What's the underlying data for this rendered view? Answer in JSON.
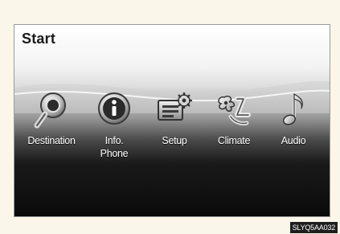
{
  "screen": {
    "title": "Start"
  },
  "menu": {
    "items": [
      {
        "label": "Destination",
        "icon": "magnifier-icon"
      },
      {
        "label": "Info.\nPhone",
        "icon": "info-icon"
      },
      {
        "label": "Setup",
        "icon": "setup-gear-icon"
      },
      {
        "label": "Climate",
        "icon": "climate-fan-icon"
      },
      {
        "label": "Audio",
        "icon": "music-note-icon"
      }
    ]
  },
  "caption": {
    "code": "SLYQ5AA032"
  },
  "colors": {
    "frame_background": "#fbf6ea",
    "label_text": "#ffffff",
    "title_text": "#1a1a1a"
  }
}
